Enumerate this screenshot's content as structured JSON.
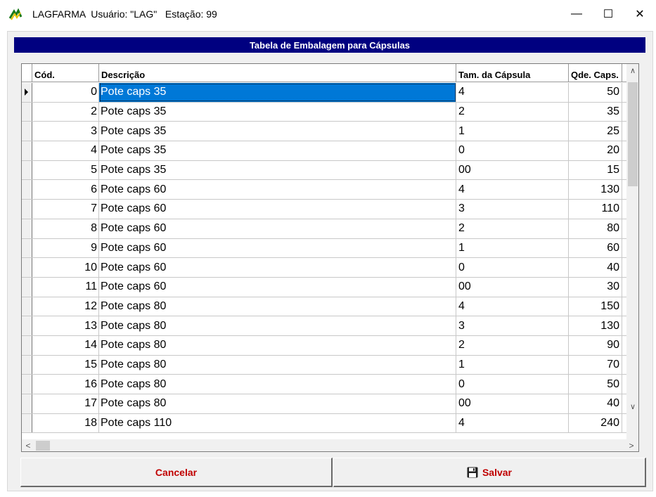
{
  "window": {
    "title": "LAGFARMA  Usuário: \"LAG\"   Estação: 99",
    "minimize": "—",
    "maximize": "☐",
    "close": "✕"
  },
  "header": {
    "title": "Tabela de Embalagem para Cápsulas"
  },
  "grid": {
    "columns": [
      "Cód.",
      "Descrição",
      "Tam. da Cápsula",
      "Qde. Caps."
    ],
    "selected_row": 0,
    "rows": [
      {
        "cod": "0",
        "desc": "Pote caps 35",
        "tam": "4",
        "qde": "50"
      },
      {
        "cod": "2",
        "desc": "Pote caps 35",
        "tam": "2",
        "qde": "35"
      },
      {
        "cod": "3",
        "desc": "Pote caps 35",
        "tam": "1",
        "qde": "25"
      },
      {
        "cod": "4",
        "desc": "Pote caps 35",
        "tam": "0",
        "qde": "20"
      },
      {
        "cod": "5",
        "desc": "Pote caps 35",
        "tam": "00",
        "qde": "15"
      },
      {
        "cod": "6",
        "desc": "Pote caps 60",
        "tam": "4",
        "qde": "130"
      },
      {
        "cod": "7",
        "desc": "Pote caps 60",
        "tam": "3",
        "qde": "110"
      },
      {
        "cod": "8",
        "desc": "Pote caps 60",
        "tam": "2",
        "qde": "80"
      },
      {
        "cod": "9",
        "desc": "Pote caps 60",
        "tam": "1",
        "qde": "60"
      },
      {
        "cod": "10",
        "desc": "Pote caps 60",
        "tam": "0",
        "qde": "40"
      },
      {
        "cod": "11",
        "desc": "Pote caps 60",
        "tam": "00",
        "qde": "30"
      },
      {
        "cod": "12",
        "desc": "Pote caps 80",
        "tam": "4",
        "qde": "150"
      },
      {
        "cod": "13",
        "desc": "Pote caps 80",
        "tam": "3",
        "qde": "130"
      },
      {
        "cod": "14",
        "desc": "Pote caps 80",
        "tam": "2",
        "qde": "90"
      },
      {
        "cod": "15",
        "desc": "Pote caps 80",
        "tam": "1",
        "qde": "70"
      },
      {
        "cod": "16",
        "desc": "Pote caps 80",
        "tam": "0",
        "qde": "50"
      },
      {
        "cod": "17",
        "desc": "Pote caps 80",
        "tam": "00",
        "qde": "40"
      },
      {
        "cod": "18",
        "desc": "Pote caps 110",
        "tam": "4",
        "qde": "240"
      }
    ]
  },
  "buttons": {
    "cancel": "Cancelar",
    "save": "Salvar"
  },
  "icons": {
    "app": "app-logo-icon",
    "save": "floppy-disk-icon"
  },
  "colors": {
    "header_bg": "#000080",
    "selection": "#0078d7",
    "button_text": "#c00000"
  }
}
